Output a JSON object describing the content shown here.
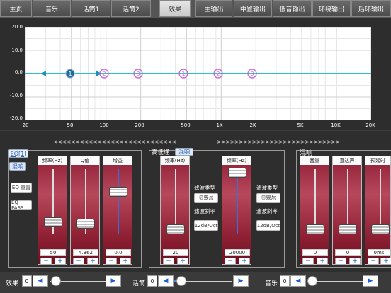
{
  "tabs": [
    {
      "label": "主页",
      "active": false
    },
    {
      "label": "音乐",
      "active": false
    },
    {
      "label": "话筒1",
      "active": false
    },
    {
      "label": "话筒2",
      "active": false
    },
    {
      "label": "效果",
      "active": true
    },
    {
      "label": "主输出",
      "active": false
    },
    {
      "label": "中置输出",
      "active": false
    },
    {
      "label": "低音输出",
      "active": false
    },
    {
      "label": "环绕输出",
      "active": false
    },
    {
      "label": "后环输出",
      "active": false
    }
  ],
  "graph": {
    "y_ticks": [
      "20.0",
      "10.0",
      "0.0",
      "-10.0",
      "-20.0"
    ],
    "x_ticks": [
      "20",
      "50",
      "100",
      "200",
      "500",
      "1K",
      "2K",
      "5K",
      "10K",
      "20K"
    ],
    "bands": [
      "1",
      "2",
      "3",
      "1",
      "2",
      "3"
    ],
    "colors": {
      "curve": "#2bbfd8",
      "marker": "#c76bd6",
      "band1": "#1a8fc0"
    }
  },
  "arrows": {
    "left": "<<<<<<<<<<<<<<<<<<<<<<<<<<<<",
    "right": ">>>>>>>>>>>>>>>>>>>>>>>>>>>>"
  },
  "eq_panel": {
    "eq_tab": "EQ[1]",
    "reverb_tab": "混响",
    "eq_reset": "EQ 重置",
    "eq_pass": "EQ PASS",
    "strips": [
      {
        "title": "频率(Hz)",
        "value": "50"
      },
      {
        "title": "Q值",
        "value": "4.362"
      },
      {
        "title": "增益",
        "value": "0.0"
      }
    ]
  },
  "filter_panel": {
    "title": "高低通",
    "tab": "混响",
    "strips": [
      {
        "title": "频率(Hz)",
        "value": "20"
      },
      {
        "title": "频率(Hz)",
        "value": "20000"
      }
    ],
    "type_label": "滤波类型",
    "type_value": "贝塞尔",
    "slope_label": "滤波斜率",
    "slope_value": "12dB/Oct"
  },
  "reverb_panel": {
    "title": "混响",
    "strips": [
      {
        "title": "音量",
        "value": "0"
      },
      {
        "title": "直达声",
        "value": "0"
      },
      {
        "title": "预延时",
        "value": "0ms"
      }
    ]
  },
  "symbols": {
    "minus": "−",
    "plus": "+",
    "left": "◀",
    "right": "▶"
  },
  "bottom": {
    "effect": {
      "label": "效果",
      "value": "0"
    },
    "mic": {
      "label": "话筒",
      "value": "0"
    },
    "music": {
      "label": "音乐",
      "value": "0"
    }
  }
}
